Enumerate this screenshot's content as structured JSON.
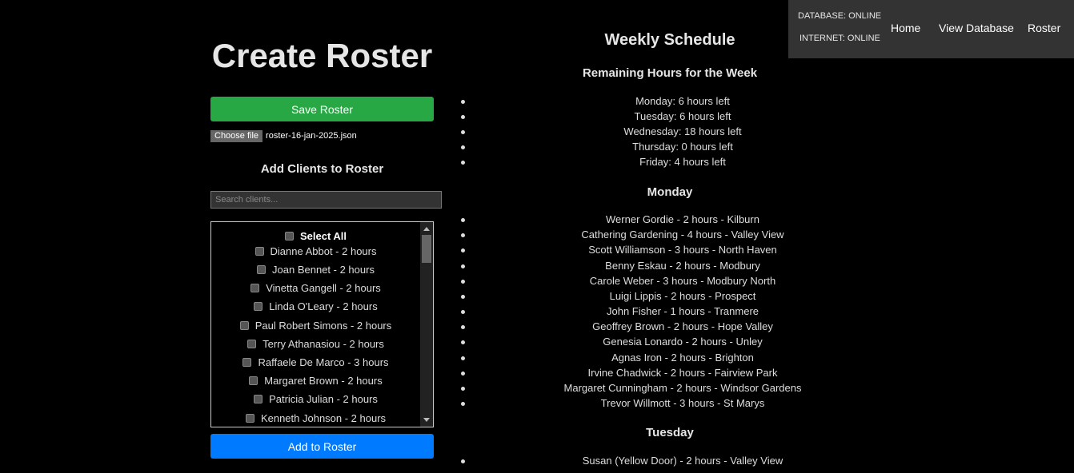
{
  "topbar": {
    "database_status": "DATABASE: ONLINE",
    "internet_status": "INTERNET: ONLINE",
    "nav": [
      "Home",
      "View Database",
      "Roster"
    ]
  },
  "left": {
    "title": "Create Roster",
    "save_label": "Save Roster",
    "file_button_label": "Choose file",
    "file_name": "roster-16-jan-2025.json",
    "add_clients_heading": "Add Clients to Roster",
    "search_placeholder": "Search clients...",
    "select_all_label": "Select All",
    "clients": [
      "Dianne Abbot - 2 hours",
      "Joan Bennet - 2 hours",
      "Vinetta Gangell - 2 hours",
      "Linda O'Leary - 2 hours",
      "Paul Robert Simons - 2 hours",
      "Terry Athanasiou - 2 hours",
      "Raffaele De Marco - 3 hours",
      "Margaret Brown - 2 hours",
      "Patricia Julian - 2 hours",
      "Kenneth Johnson - 2 hours"
    ],
    "add_label": "Add to Roster"
  },
  "schedule": {
    "title": "Weekly Schedule",
    "remaining_heading": "Remaining Hours for the Week",
    "remaining": [
      "Monday: 6 hours left",
      "Tuesday: 6 hours left",
      "Wednesday: 18 hours left",
      "Thursday: 0 hours left",
      "Friday: 4 hours left"
    ],
    "monday_heading": "Monday",
    "monday": [
      "Werner Gordie - 2 hours - Kilburn",
      "Cathering Gardening - 4 hours - Valley View",
      "Scott Williamson - 3 hours - North Haven",
      "Benny Eskau - 2 hours - Modbury",
      "Carole Weber - 3 hours - Modbury North",
      "Luigi Lippis - 2 hours - Prospect",
      "John Fisher - 1 hours - Tranmere",
      "Geoffrey Brown - 2 hours - Hope Valley",
      "Genesia Lonardo - 2 hours - Unley",
      "Agnas Iron - 2 hours - Brighton",
      "Irvine Chadwick - 2 hours - Fairview Park",
      "Margaret Cunningham - 2 hours - Windsor Gardens",
      "Trevor Willmott - 3 hours - St Marys"
    ],
    "tuesday_heading": "Tuesday",
    "tuesday": [
      "Susan (Yellow Door) - 2 hours - Valley View"
    ]
  }
}
